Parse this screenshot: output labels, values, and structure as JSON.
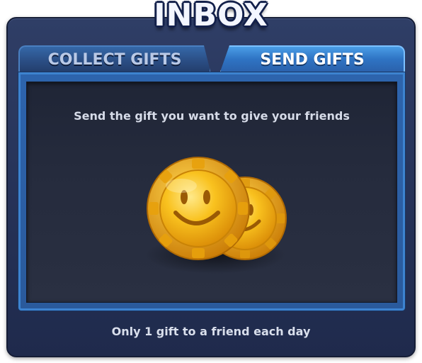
{
  "header": {
    "title": "INBOX"
  },
  "tabs": [
    {
      "label": "COLLECT GIFTS",
      "selected": false
    },
    {
      "label": "SEND GIFTS",
      "selected": true
    }
  ],
  "content": {
    "instruction": "Send the gift you want to give your friends",
    "gift_icon": "smiley-coin-icon"
  },
  "footer": {
    "note": "Only 1 gift to a friend each day"
  },
  "colors": {
    "panel": "#27345a",
    "tab_active": "#2f74c4",
    "tab_inactive": "#2b4f86",
    "content_bg": "#252b3d",
    "coin_gold": "#f5b614"
  }
}
